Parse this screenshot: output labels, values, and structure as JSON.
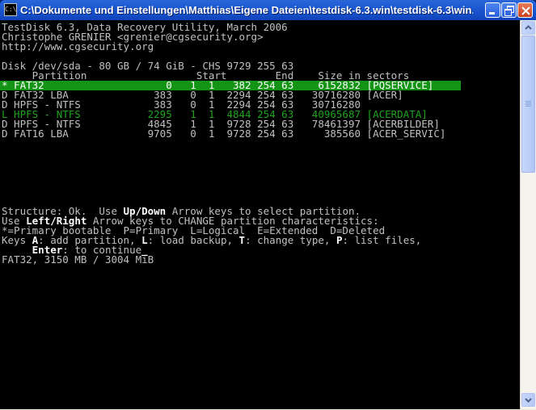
{
  "window": {
    "title": "C:\\Dokumente und Einstellungen\\Matthias\\Eigene Dateien\\testdisk-6.3.win\\testdisk-6.3\\win..."
  },
  "console": {
    "header": [
      "TestDisk 6.3, Data Recovery Utility, March 2006",
      "Christophe GRENIER <grenier@cgsecurity.org>",
      "http://www.cgsecurity.org"
    ],
    "disk": "Disk /dev/sda - 80 GB / 74 GiB - CHS 9729 255 63",
    "columns": "     Partition                  Start        End    Size in sectors",
    "partitions": [
      "* FAT32                    0   1  1   382 254 63    6152832 [PQSERVICE]",
      "D FAT32 LBA              383   0  1  2294 254 63   30716280 [ACER]",
      "D HPFS - NTFS            383   0  1  2294 254 63   30716280",
      "L HPFS - NTFS           2295   1  1  4844 254 63   40965687 [ACERDATA]",
      "D HPFS - NTFS           4845   1  1  9728 254 63   78461397 [ACERBILDER]",
      "D FAT16 LBA             9705   0  1  9728 254 63     385560 [ACER_SERVIC]"
    ],
    "help": {
      "l1_a": "Structure: Ok.  Use ",
      "l1_key": "Up/Down",
      "l1_b": " Arrow keys to select partition.",
      "l2_a": "Use ",
      "l2_key": "Left/Right",
      "l2_b": " Arrow keys to CHANGE partition characteristics:",
      "l3": "*=Primary bootable  P=Primary  L=Logical  E=Extended  D=Deleted",
      "l4_a": "Keys ",
      "l4_k1": "A",
      "l4_b": ": add partition, ",
      "l4_k2": "L",
      "l4_c": ": load backup, ",
      "l4_k3": "T",
      "l4_d": ": change type, ",
      "l4_k4": "P",
      "l4_e": ": list files,",
      "l5_a": "     ",
      "l5_key": "Enter",
      "l5_b": ": to continue",
      "cursor": "_",
      "status": "FAT32, 3150 MB / 3004 MiB"
    }
  },
  "colors": {
    "selected_bg": "#149414",
    "ghost_fg": "#1fa31f",
    "console_fg": "#c0c0c0"
  }
}
